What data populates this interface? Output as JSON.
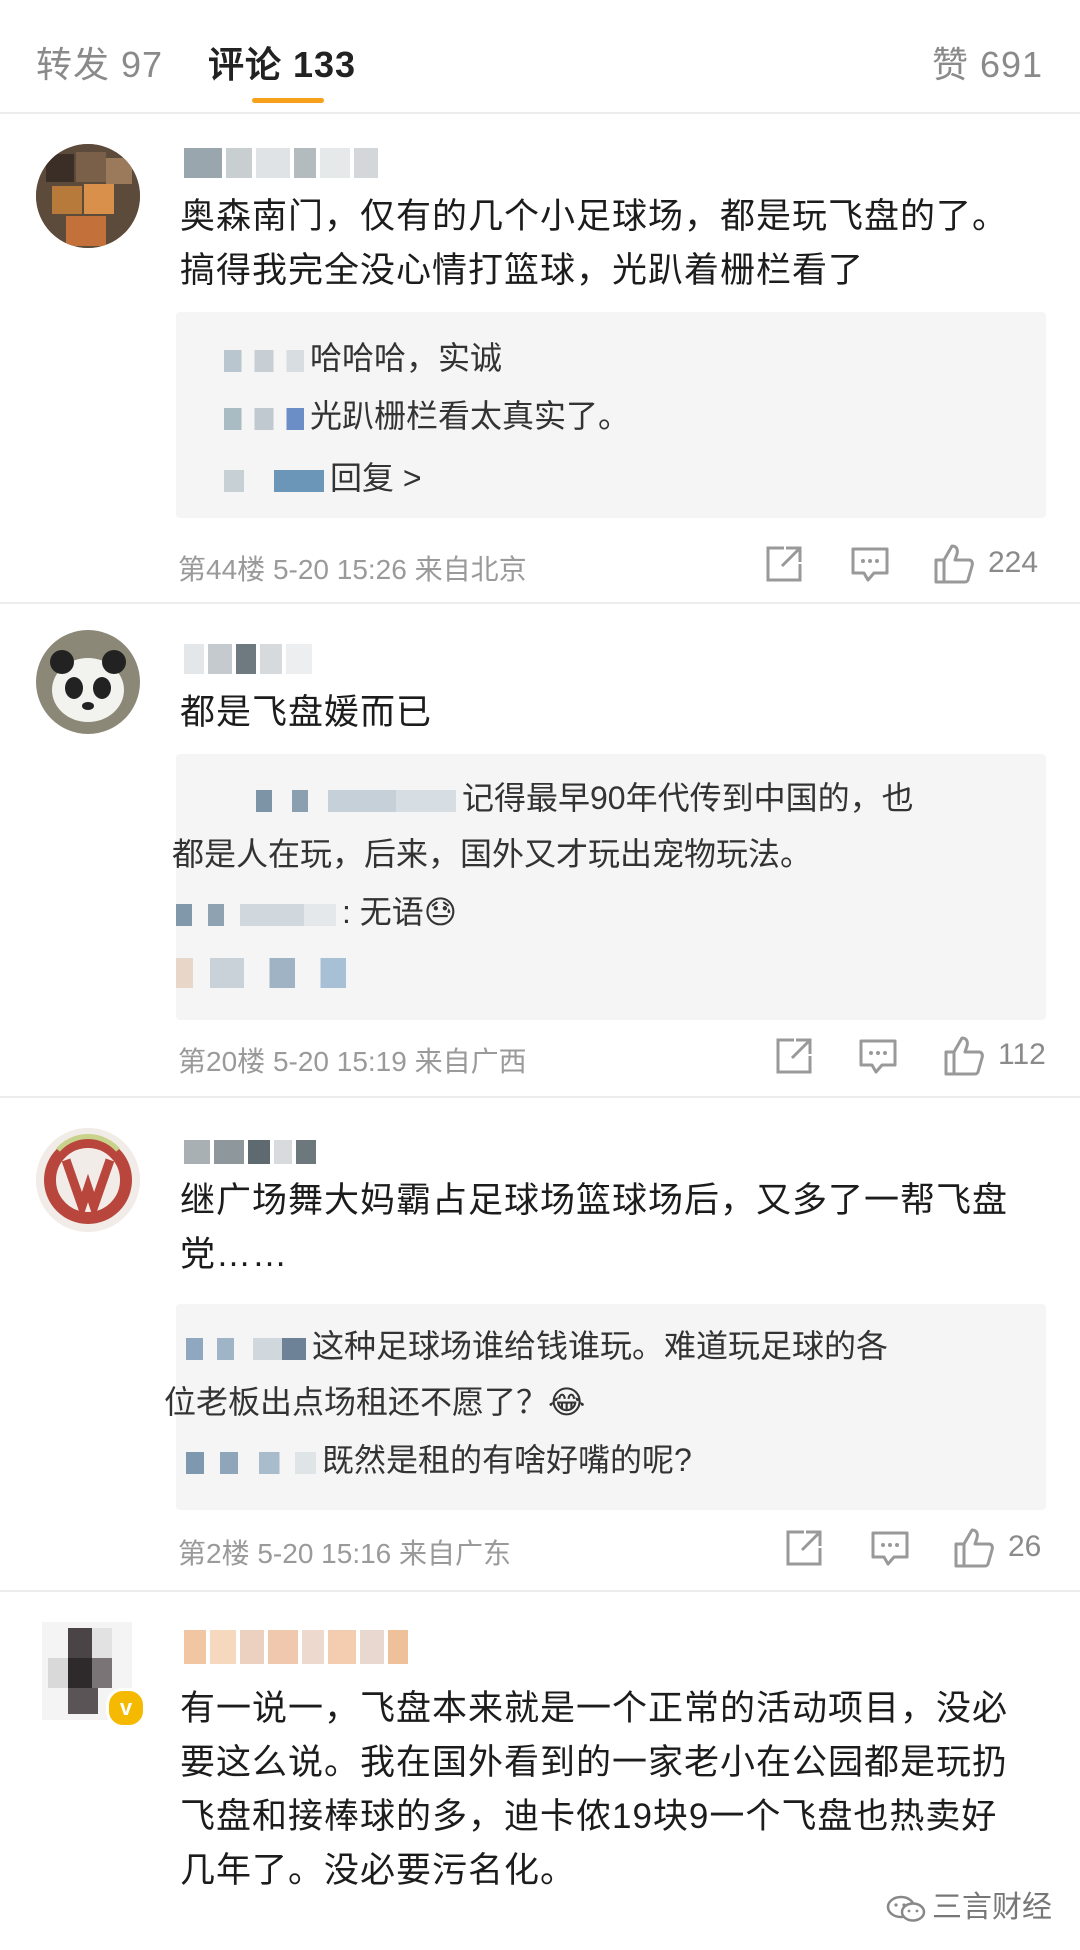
{
  "tabs": [
    {
      "label": "转发 97"
    },
    {
      "label": "评论 133"
    },
    {
      "label": "赞 691"
    }
  ],
  "comments": [
    {
      "text": "奥森南门，仅有的几个小足球场，都是玩飞盘的了。搞得我完全没心情打篮球，光趴着栅栏看了",
      "replies": [
        "哈哈哈，实诚",
        "光趴栅栏看太真实了。",
        "回复 >"
      ],
      "floor": "第44楼",
      "time": "5-20 15:26",
      "location": "来自北京",
      "likes": "224"
    },
    {
      "text": "都是飞盘媛而已",
      "replies": [
        "记得最早90年代传到中国的，也",
        "都是人在玩，后来，国外又才玩出宠物玩法。",
        ": 无语😓"
      ],
      "floor": "第20楼",
      "time": "5-20 15:19",
      "location": "来自广西",
      "likes": "112"
    },
    {
      "text": "继广场舞大妈霸占足球场篮球场后，又多了一帮飞盘党……",
      "replies": [
        "这种足球场谁给钱谁玩。难道玩足球的各",
        "位老板出点场租还不愿了？😂",
        "既然是租的有啥好嘴的呢?"
      ],
      "floor": "第2楼",
      "time": "5-20 15:16",
      "location": "来自广东",
      "likes": "26"
    },
    {
      "text": "有一说一，飞盘本来就是一个正常的活动项目，没必要这么说。我在国外看到的一家老小在公园都是玩扔飞盘和接棒球的多，迪卡侬19块9一个飞盘也热卖好几年了。没必要污名化。"
    }
  ],
  "watermark": "三言财经",
  "colors": {
    "accent": "#f7a11a",
    "meta": "#9a9a9a",
    "reply_bg": "#f5f5f5",
    "verified": "#f5b900"
  },
  "icons": [
    "share-icon",
    "comment-icon",
    "like-icon",
    "verified-badge-icon",
    "wechat-icon"
  ]
}
